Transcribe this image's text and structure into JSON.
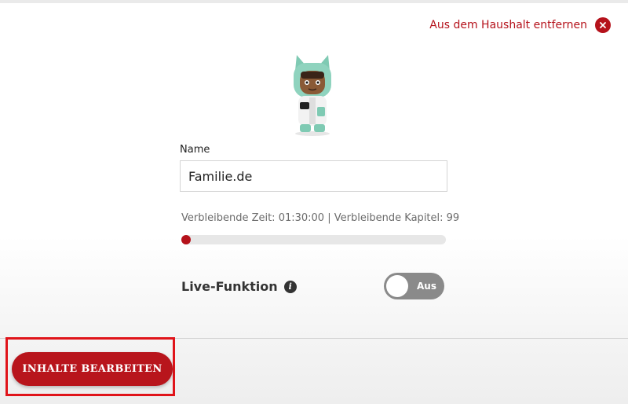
{
  "header": {
    "remove_household_label": "Aus dem Haushalt entfernen"
  },
  "figure": {
    "icon": "creative-tonie-figure"
  },
  "name_field": {
    "label": "Name",
    "value": "Familie.de"
  },
  "remaining": {
    "text": "Verbleibende Zeit: 01:30:00 | Verbleibende Kapitel: 99",
    "progress": 0.0
  },
  "live_function": {
    "label": "Live-Funktion",
    "toggle_text": "Aus",
    "enabled": false
  },
  "actions": {
    "edit_contents_label": "INHALTE BEARBEITEN"
  },
  "colors": {
    "accent": "#b5121b",
    "highlight": "#e0141a",
    "toggle_off": "#8a8a8a"
  }
}
